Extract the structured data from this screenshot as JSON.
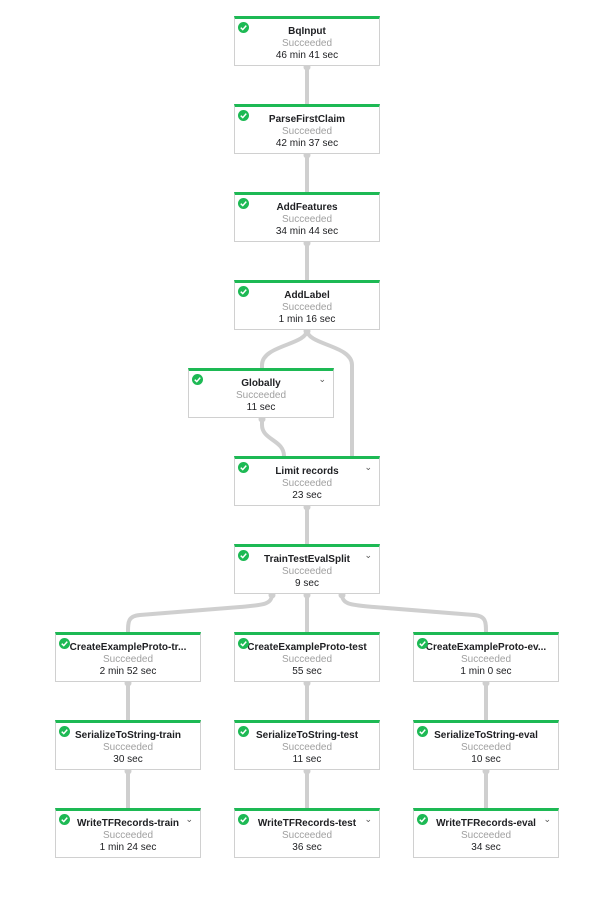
{
  "colors": {
    "success": "#1db954",
    "edge": "#cfcfcf"
  },
  "nodes": [
    {
      "id": "bq",
      "name": "BqInput",
      "status": "Succeeded",
      "duration": "46 min 41 sec",
      "expand": false
    },
    {
      "id": "parse",
      "name": "ParseFirstClaim",
      "status": "Succeeded",
      "duration": "42 min 37 sec",
      "expand": false
    },
    {
      "id": "feat",
      "name": "AddFeatures",
      "status": "Succeeded",
      "duration": "34 min 44 sec",
      "expand": false
    },
    {
      "id": "label",
      "name": "AddLabel",
      "status": "Succeeded",
      "duration": "1 min 16 sec",
      "expand": false
    },
    {
      "id": "glob",
      "name": "Globally",
      "status": "Succeeded",
      "duration": "11 sec",
      "expand": true
    },
    {
      "id": "limit",
      "name": "Limit records",
      "status": "Succeeded",
      "duration": "23 sec",
      "expand": true
    },
    {
      "id": "split",
      "name": "TrainTestEvalSplit",
      "status": "Succeeded",
      "duration": "9 sec",
      "expand": true
    },
    {
      "id": "cetr",
      "name": "CreateExampleProto-tr...",
      "status": "Succeeded",
      "duration": "2 min 52 sec",
      "expand": false
    },
    {
      "id": "cete",
      "name": "CreateExampleProto-test",
      "status": "Succeeded",
      "duration": "55 sec",
      "expand": false
    },
    {
      "id": "ceev",
      "name": "CreateExampleProto-ev...",
      "status": "Succeeded",
      "duration": "1 min 0 sec",
      "expand": false
    },
    {
      "id": "sstr",
      "name": "SerializeToString-train",
      "status": "Succeeded",
      "duration": "30 sec",
      "expand": false
    },
    {
      "id": "sste",
      "name": "SerializeToString-test",
      "status": "Succeeded",
      "duration": "11 sec",
      "expand": false
    },
    {
      "id": "ssev",
      "name": "SerializeToString-eval",
      "status": "Succeeded",
      "duration": "10 sec",
      "expand": false
    },
    {
      "id": "wtr",
      "name": "WriteTFRecords-train",
      "status": "Succeeded",
      "duration": "1 min 24 sec",
      "expand": true
    },
    {
      "id": "wte",
      "name": "WriteTFRecords-test",
      "status": "Succeeded",
      "duration": "36 sec",
      "expand": true
    },
    {
      "id": "wev",
      "name": "WriteTFRecords-eval",
      "status": "Succeeded",
      "duration": "34 sec",
      "expand": true
    }
  ],
  "edges": [
    [
      "bq",
      "parse"
    ],
    [
      "parse",
      "feat"
    ],
    [
      "feat",
      "label"
    ],
    [
      "label",
      "glob"
    ],
    [
      "label",
      "limit"
    ],
    [
      "glob",
      "limit"
    ],
    [
      "limit",
      "split"
    ],
    [
      "split",
      "cetr"
    ],
    [
      "split",
      "cete"
    ],
    [
      "split",
      "ceev"
    ],
    [
      "cetr",
      "sstr"
    ],
    [
      "cete",
      "sste"
    ],
    [
      "ceev",
      "ssev"
    ],
    [
      "sstr",
      "wtr"
    ],
    [
      "sste",
      "wte"
    ],
    [
      "ssev",
      "wev"
    ]
  ]
}
